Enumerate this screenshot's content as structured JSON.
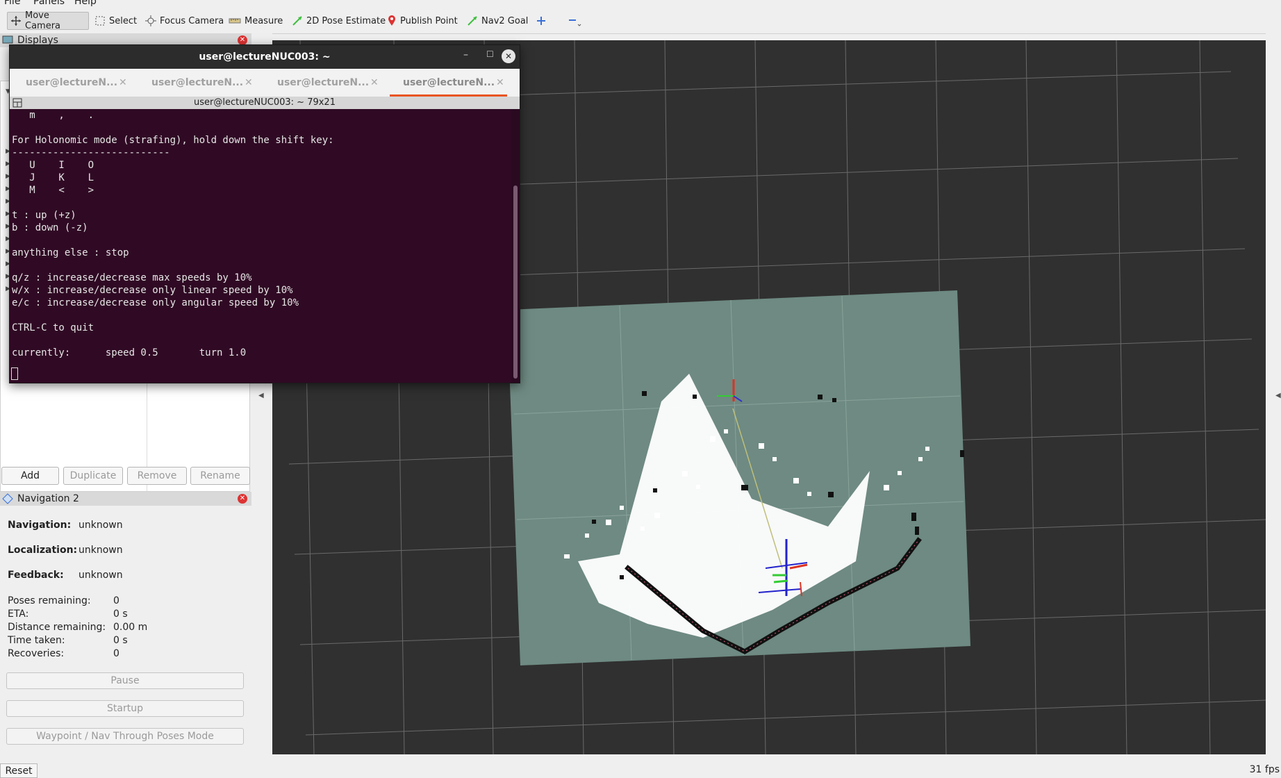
{
  "menu": {
    "file": "File",
    "panels": "Panels",
    "help": "Help"
  },
  "toolbar": {
    "move_camera": "Move Camera",
    "select": "Select",
    "focus_camera": "Focus Camera",
    "measure": "Measure",
    "pose_estimate": "2D Pose Estimate",
    "publish_point": "Publish Point",
    "nav2_goal": "Nav2 Goal"
  },
  "displays_panel": {
    "title": "Displays",
    "buttons": {
      "add": "Add",
      "duplicate": "Duplicate",
      "remove": "Remove",
      "rename": "Rename"
    }
  },
  "nav_panel": {
    "title": "Navigation 2",
    "navigation_label": "Navigation:",
    "navigation_value": "unknown",
    "localization_label": "Localization:",
    "localization_value": "unknown",
    "feedback_label": "Feedback:",
    "feedback_value": "unknown",
    "poses_remaining_label": "Poses remaining:",
    "poses_remaining_value": "0",
    "eta_label": "ETA:",
    "eta_value": "0 s",
    "distance_label": "Distance remaining:",
    "distance_value": "0.00 m",
    "time_taken_label": "Time taken:",
    "time_taken_value": "0 s",
    "recoveries_label": "Recoveries:",
    "recoveries_value": "0",
    "pause_button": "Pause",
    "startup_button": "Startup",
    "waypoint_button": "Waypoint / Nav Through Poses Mode"
  },
  "terminal": {
    "title": "user@lectureNUC003: ~",
    "tabs": [
      "user@lectureN...",
      "user@lectureN...",
      "user@lectureN...",
      "user@lectureN..."
    ],
    "subtitle": "user@lectureNUC003: ~ 79x21",
    "lines": [
      "   m    ,    .",
      "",
      "For Holonomic mode (strafing), hold down the shift key:",
      "---------------------------",
      "   U    I    O",
      "   J    K    L",
      "   M    <    >",
      "",
      "t : up (+z)",
      "b : down (-z)",
      "",
      "anything else : stop",
      "",
      "q/z : increase/decrease max speeds by 10%",
      "w/x : increase/decrease only linear speed by 10%",
      "e/c : increase/decrease only angular speed by 10%",
      "",
      "CTRL-C to quit",
      "",
      "currently:      speed 0.5       turn 1.0"
    ]
  },
  "footer": {
    "reset": "Reset",
    "fps": "31 fps"
  },
  "colors": {
    "terminal_bg": "#300a24",
    "viewport_bg": "#303030",
    "map_bg": "#6e8a82",
    "accent_tab": "#e95420"
  }
}
